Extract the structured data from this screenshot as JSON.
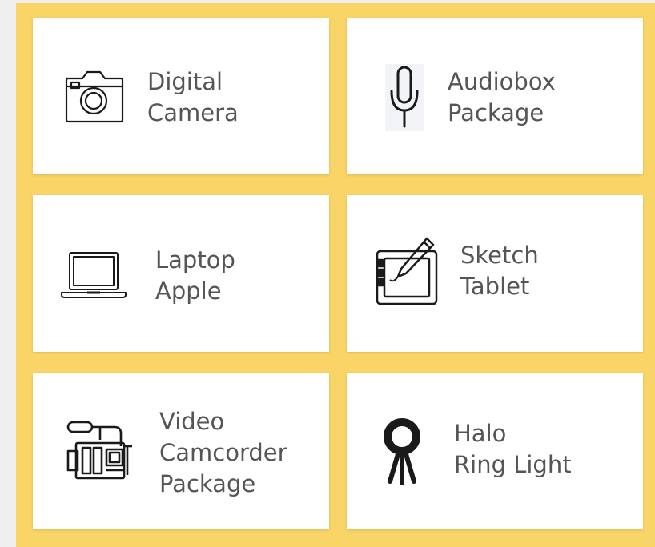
{
  "equipment": {
    "items": [
      {
        "lines": [
          "Digital",
          "Camera"
        ],
        "icon": "camera-icon"
      },
      {
        "lines": [
          "Audiobox",
          "Package"
        ],
        "icon": "microphone-icon"
      },
      {
        "lines": [
          "Laptop",
          "Apple"
        ],
        "icon": "laptop-icon"
      },
      {
        "lines": [
          "Sketch",
          "Tablet"
        ],
        "icon": "drawing-tablet-icon"
      },
      {
        "lines": [
          "Video",
          "Camcorder",
          "Package"
        ],
        "icon": "camcorder-icon"
      },
      {
        "lines": [
          "Halo",
          "Ring Light"
        ],
        "icon": "ring-light-icon"
      }
    ]
  },
  "colors": {
    "background": "#f9d567",
    "card": "#ffffff",
    "text": "#555555",
    "icon": "#1a1a1a"
  }
}
